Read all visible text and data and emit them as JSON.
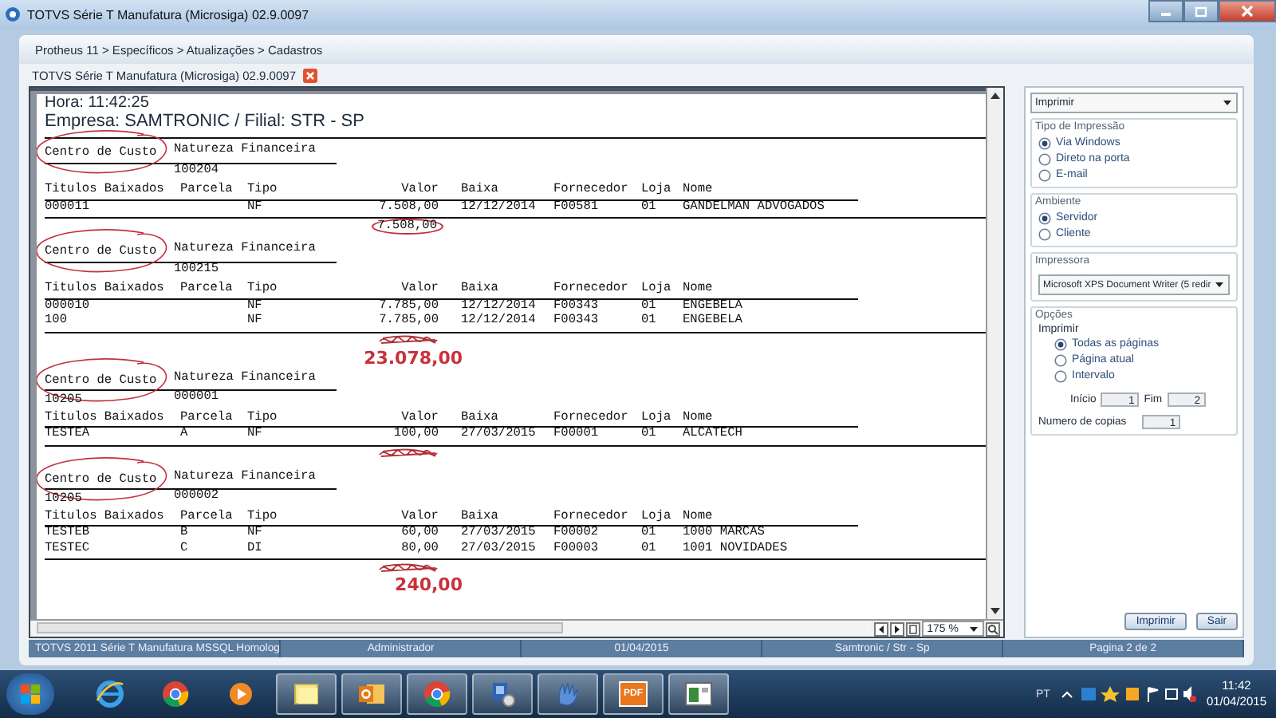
{
  "window": {
    "title": "TOTVS Série T Manufatura (Microsiga) 02.9.0097"
  },
  "breadcrumb": "Protheus 11 > Específicos > Atualizações > Cadastros",
  "tab": {
    "label": "TOTVS Série T Manufatura (Microsiga) 02.9.0097"
  },
  "report": {
    "time_line": "Hora: 11:42:25",
    "company_line": "Empresa: SAMTRONIC / Filial: STR - SP",
    "groups": [
      {
        "cost_center_label": "Centro de Custo",
        "nature_label": "Natureza Financeira",
        "nature": "100204",
        "label_circled": true,
        "columns": [
          "Titulos Baixados",
          "Parcela",
          "Tipo",
          "Valor",
          "Baixa",
          "Fornecedor",
          "Loja",
          "Nome"
        ],
        "rows": [
          {
            "titulo": "000011",
            "tipo": "NF",
            "valor": "7.508,00",
            "baixa": "12/12/2014",
            "fornecedor": "F00581",
            "loja": "01",
            "nome": "GANDELMAN ADVOGADOS"
          }
        ],
        "subtotal": {
          "kind": "circled",
          "text": "7.508,00"
        }
      },
      {
        "cost_center_label": "Centro de Custo",
        "nature_label": "Natureza Financeira",
        "nature": "100215",
        "label_circled": true,
        "columns": [
          "Titulos Baixados",
          "Parcela",
          "Tipo",
          "Valor",
          "Baixa",
          "Fornecedor",
          "Loja",
          "Nome"
        ],
        "rows": [
          {
            "titulo": "000010",
            "tipo": "NF",
            "valor": "7.785,00",
            "baixa": "12/12/2014",
            "fornecedor": "F00343",
            "loja": "01",
            "nome": "ENGEBELA"
          },
          {
            "titulo": "100",
            "tipo": "NF",
            "valor": "7.785,00",
            "baixa": "12/12/2014",
            "fornecedor": "F00343",
            "loja": "01",
            "nome": "ENGEBELA"
          }
        ],
        "subtotal": {
          "kind": "scribbled"
        },
        "handwritten_total": "23.078,00"
      },
      {
        "cost_center_label": "Centro de Custo",
        "nature_label": "Natureza Financeira",
        "cost_center": "10205",
        "nature": "000001",
        "label_circled": true,
        "columns": [
          "Titulos Baixados",
          "Parcela",
          "Tipo",
          "Valor",
          "Baixa",
          "Fornecedor",
          "Loja",
          "Nome"
        ],
        "rows": [
          {
            "titulo": "TESTEA",
            "parcela": "A",
            "tipo": "NF",
            "valor": "100,00",
            "baixa": "27/03/2015",
            "fornecedor": "F00001",
            "loja": "01",
            "nome": "ALCATECH"
          }
        ],
        "subtotal": {
          "kind": "scribbled"
        }
      },
      {
        "cost_center_label": "Centro de Custo",
        "nature_label": "Natureza Financeira",
        "cost_center": "10205",
        "nature": "000002",
        "label_circled": true,
        "columns": [
          "Titulos Baixados",
          "Parcela",
          "Tipo",
          "Valor",
          "Baixa",
          "Fornecedor",
          "Loja",
          "Nome"
        ],
        "rows": [
          {
            "titulo": "TESTEB",
            "parcela": "B",
            "tipo": "NF",
            "valor": "60,00",
            "baixa": "27/03/2015",
            "fornecedor": "F00002",
            "loja": "01",
            "nome": "1000 MARCAS"
          },
          {
            "titulo": "TESTEC",
            "parcela": "C",
            "tipo": "DI",
            "valor": "80,00",
            "baixa": "27/03/2015",
            "fornecedor": "F00003",
            "loja": "01",
            "nome": "1001 NOVIDADES"
          }
        ],
        "subtotal": {
          "kind": "scribbled"
        },
        "handwritten_total": "240,00"
      }
    ]
  },
  "viewer": {
    "zoom": "175 %"
  },
  "print_panel": {
    "action": "Imprimir",
    "sections": [
      {
        "kind": "radios",
        "legend": "Tipo de Impressão",
        "options": [
          {
            "label": "Via Windows",
            "selected": true
          },
          {
            "label": "Direto na porta",
            "selected": false
          },
          {
            "label": "E-mail",
            "selected": false
          }
        ]
      },
      {
        "kind": "radios",
        "legend": "Ambiente",
        "options": [
          {
            "label": "Servidor",
            "selected": true
          },
          {
            "label": "Cliente",
            "selected": false
          }
        ]
      },
      {
        "kind": "select",
        "legend": "Impressora",
        "value": "Microsoft XPS Document Writer (5 redir"
      },
      {
        "kind": "options",
        "legend": "Opções",
        "label": "Imprimir",
        "options": [
          {
            "label": "Todas as páginas",
            "selected": true
          },
          {
            "label": "Página atual",
            "selected": false
          },
          {
            "label": "Intervalo",
            "selected": false
          }
        ],
        "start_label": "Início",
        "start": "1",
        "end_label": "Fim",
        "end": "2",
        "copies_label": "Numero de copias",
        "copies": "1"
      }
    ],
    "buttons": [
      "Imprimir",
      "Sair"
    ]
  },
  "status_bar": [
    "TOTVS 2011 Série T Manufatura MSSQL Homolog",
    "Administrador",
    "01/04/2015",
    "Samtronic / Str - Sp",
    "Pagina 2 de 2"
  ],
  "taskbar": {
    "items": [
      {
        "kind": "ie",
        "open": false
      },
      {
        "kind": "chrome",
        "open": false
      },
      {
        "kind": "media",
        "open": false
      },
      {
        "kind": "notes",
        "open": true
      },
      {
        "kind": "outlook",
        "open": true
      },
      {
        "kind": "chrome",
        "open": true
      },
      {
        "kind": "network",
        "open": true
      },
      {
        "kind": "pen",
        "open": true
      },
      {
        "kind": "pdf",
        "open": true,
        "label": "PDF"
      },
      {
        "kind": "window",
        "open": true
      }
    ],
    "language": "PT",
    "time": "11:42",
    "date": "01/04/2015"
  }
}
